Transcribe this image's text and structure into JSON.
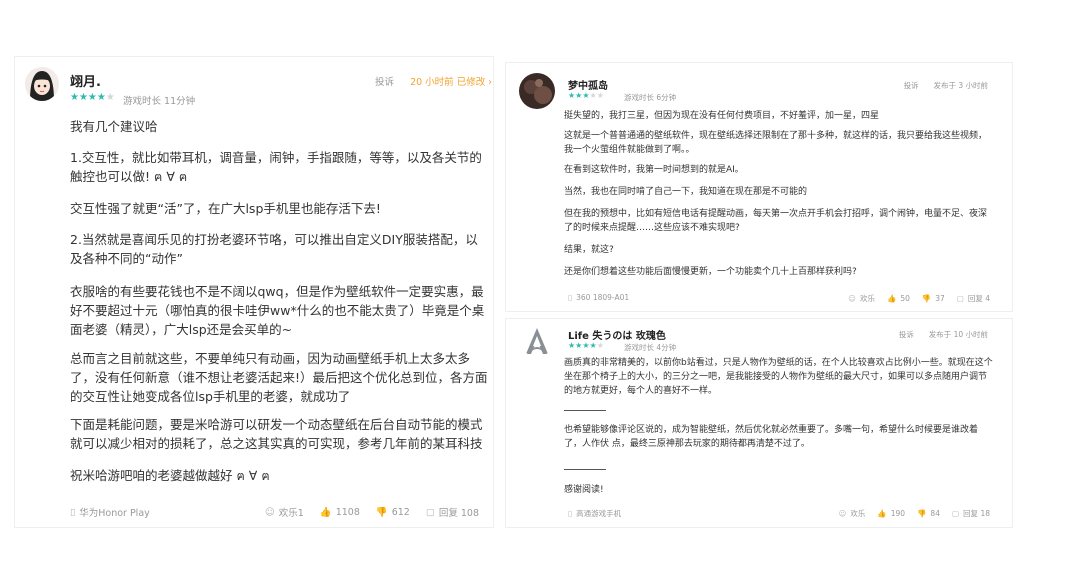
{
  "left": {
    "username": "翊月.",
    "stars": "★★★★",
    "stars_off": "★",
    "playtime": "游戏时长 11分钟",
    "report_label": "投诉",
    "edited_label": "20 小时前 已修改 ›",
    "paragraphs": [
      "我有几个建议哈",
      "1.交互性，就比如带耳机，调音量，闹钟，手指跟随，等等，以及各关节的触控也可以做! ฅ ∀ ฅ",
      "交互性强了就更“活”了，在广大lsp手机里也能存活下去!",
      "2.当然就是喜闻乐见的打扮老婆环节咯，可以推出自定义DIY服装搭配，以及各种不同的“动作”",
      "衣服啥的有些要花钱也不是不阔以qwq，但是作为壁纸软件一定要实惠，最好不要超过十元（哪怕真的很卡哇伊ww*什么的也不能太贵了）毕竟是个桌面老婆（精灵），广大lsp还是会买单的~",
      "总而言之目前就这些，不要单纯只有动画，因为动画壁纸手机上太多太多了，没有任何新意（谁不想让老婆活起来!）最后把这个优化总到位，各方面的交互性让她变成各位lsp手机里的老婆，就成功了",
      "下面是耗能问题，要是米哈游可以研发一个动态壁纸在后台自动节能的模式就可以减少相对的损耗了，总之这其实真的可实现，参考几年前的某耳科技",
      "祝米哈游吧咱的老婆越做越好 ฅ ∀ ฅ"
    ],
    "device": "华为Honor Play",
    "stats": {
      "fun": "欢乐1",
      "likes": "1108",
      "dislikes": "612",
      "replies": "回复 108"
    }
  },
  "right_top": {
    "username": "梦中孤岛",
    "stars": "★★★",
    "stars_off": "★★",
    "playtime": "游戏时长 6分钟",
    "report_label": "投诉",
    "time_label": "发布于 3 小时前",
    "paragraphs": [
      "挺失望的，我打三星，但因为现在没有任何付费项目，不好羞评，加一星，四星",
      "这就是一个普普通通的壁纸软件，现在壁纸选择还限制在了那十多种，就这样的话，我只要给我这些视频，我一个火萤组件就能做到了啊。。",
      "在看到这软件时，我第一时间想到的就是AI。",
      "当然，我也在同时啃了自己一下，我知道在现在那是不可能的",
      "但在我的预想中，比如有短信电话有提醒动画，每天第一次点开手机会打招呼，调个闹钟，电量不足、夜深了的时候来点提醒……这些应该不难实现吧?",
      "结果，就这?",
      "还是你们想着这些功能后面慢慢更新，一个功能卖个几十上百那样获利吗?"
    ],
    "device": "360 1809-A01",
    "stats": {
      "fun": "欢乐",
      "likes": "50",
      "dislikes": "37",
      "replies": "回复 4"
    }
  },
  "right_bottom": {
    "username": "Life 失うのは 玫瑰色",
    "stars": "★★★★",
    "stars_off": "★",
    "playtime": "游戏时长 4分钟",
    "report_label": "投诉",
    "time_label": "发布于 10 小时前",
    "paragraphs": [
      "画质真的非常精美的，以前你b站看过，只是人物作为壁纸的话，在个人比较喜欢占比例小一些。就现在这个坐在那个椅子上的大小，的三分之一吧，是我能接受的人物作为壁纸的最大尺寸，如果可以多点随用户调节的地方就更好，每个人的喜好不一样。",
      "也希望能够像评论区说的，成为智能壁纸，然后优化就必然重要了。多嘴一句，希望什么时候要是谁改着了，人作伏 点，最终三原神那去玩家的期待都再清楚不过了。",
      "感谢阅读!"
    ],
    "device": "高通游戏手机",
    "stats": {
      "fun": "欢乐",
      "likes": "190",
      "dislikes": "84",
      "replies": "回复 18"
    }
  }
}
